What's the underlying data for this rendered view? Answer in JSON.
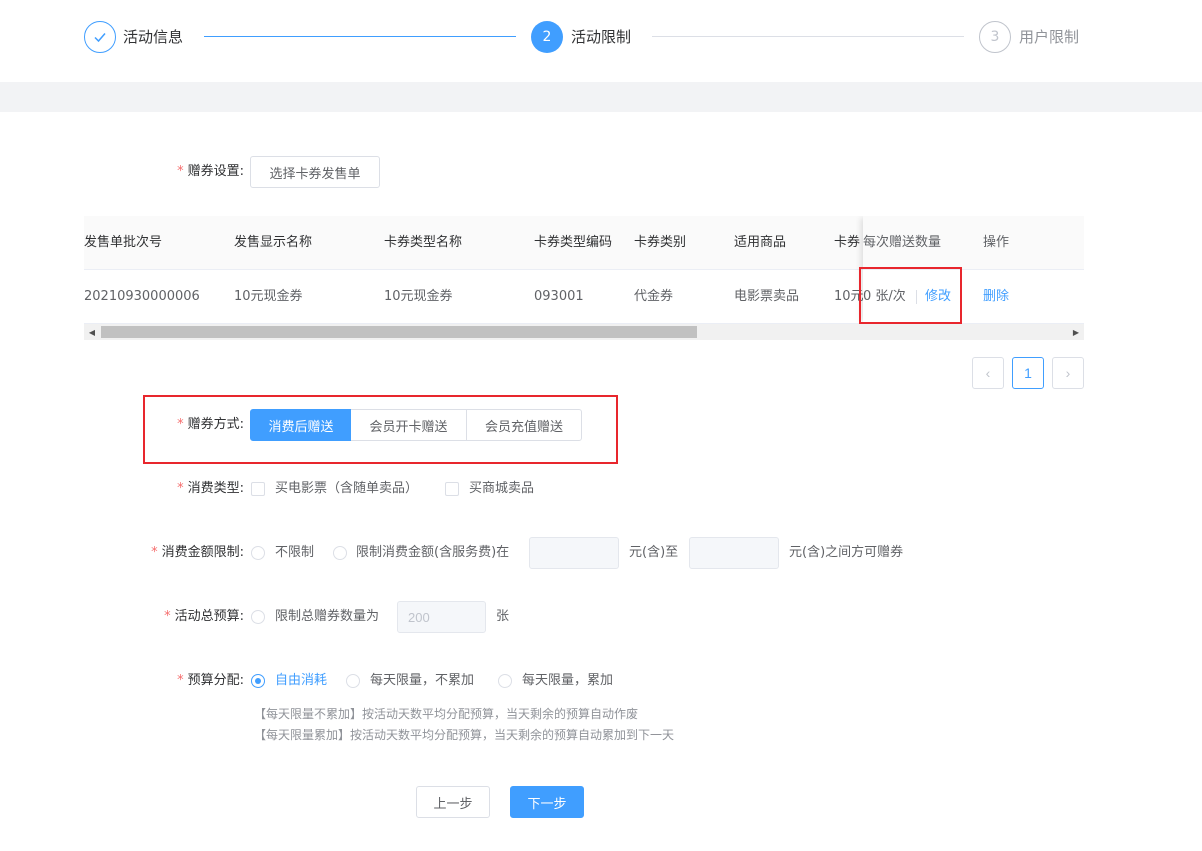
{
  "steps": [
    {
      "label": "活动信息",
      "status": "done"
    },
    {
      "label": "活动限制",
      "status": "active",
      "number": "2"
    },
    {
      "label": "用户限制",
      "status": "wait",
      "number": "3"
    }
  ],
  "coupon_setting": {
    "label": "赠券设置:",
    "select_button": "选择卡券发售单"
  },
  "table": {
    "headers": [
      "发售单批次号",
      "发售显示名称",
      "卡券类型名称",
      "卡券类型编码",
      "卡券类别",
      "适用商品",
      "卡券",
      "每次赠送数量",
      "操作"
    ],
    "rows": [
      {
        "batch_no": "20210930000006",
        "display_name": "10元现金券",
        "type_name": "10元现金券",
        "type_code": "093001",
        "category": "代金券",
        "goods": "电影票卖品",
        "coupon": "10元",
        "quantity": "0 张/次",
        "edit": "修改",
        "delete": "删除"
      }
    ]
  },
  "pagination": {
    "current": "1",
    "prev": "‹",
    "next": "›"
  },
  "gift_method": {
    "label": "赠券方式:",
    "options": [
      "消费后赠送",
      "会员开卡赠送",
      "会员充值赠送"
    ],
    "selected": "消费后赠送"
  },
  "consume_type": {
    "label": "消费类型:",
    "options": [
      "买电影票（含随单卖品）",
      "买商城卖品"
    ]
  },
  "amount_limit": {
    "label": "消费金额限制:",
    "option_none": "不限制",
    "option_limit": "限制消费金额(含服务费)在",
    "unit_to": "元(含)至",
    "unit_end": "元(含)之间方可赠券"
  },
  "budget": {
    "label": "活动总预算:",
    "option": "限制总赠券数量为",
    "value": "200",
    "unit": "张"
  },
  "allocation": {
    "label": "预算分配:",
    "options": [
      "自由消耗",
      "每天限量，不累加",
      "每天限量，累加"
    ],
    "selected": "自由消耗",
    "hints": [
      "【每天限量不累加】按活动天数平均分配预算，当天剩余的预算自动作废",
      "【每天限量累加】按活动天数平均分配预算，当天剩余的预算自动累加到下一天"
    ]
  },
  "footer": {
    "prev": "上一步",
    "next": "下一步"
  },
  "colors": {
    "primary": "#409eff",
    "highlight": "#e8262d",
    "required": "#f56c6c"
  }
}
